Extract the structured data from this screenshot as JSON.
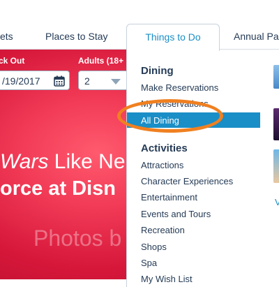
{
  "nav": {
    "tabs": [
      "ets",
      "Places to Stay",
      "Things to Do",
      "Annual Pa"
    ],
    "active_index": 2
  },
  "search": {
    "checkout_label": "ck Out",
    "checkout_value": "/19/2017",
    "adults_label": "Adults (18+",
    "adults_value": "2"
  },
  "hero": {
    "line1_italic": "Wars",
    "line1_rest": " Like Ne",
    "line2": "orce at Disn",
    "watermark": "Photos b"
  },
  "menu": {
    "dining_heading": "Dining",
    "dining_items": [
      "Make Reservations",
      "My Reservations",
      "All Dining"
    ],
    "selected_item": "All Dining",
    "activities_heading": "Activities",
    "activities_items": [
      "Attractions",
      "Character Experiences",
      "Entertainment",
      "Events and Tours",
      "Recreation",
      "Shops",
      "Spa",
      "My Wish List"
    ]
  },
  "right_column": {
    "link_text": "V"
  },
  "colors": {
    "accent_blue": "#1a8ec6",
    "text_navy": "#253b56",
    "annotation_orange": "#f08020",
    "hero_red": "#e52a4a"
  }
}
